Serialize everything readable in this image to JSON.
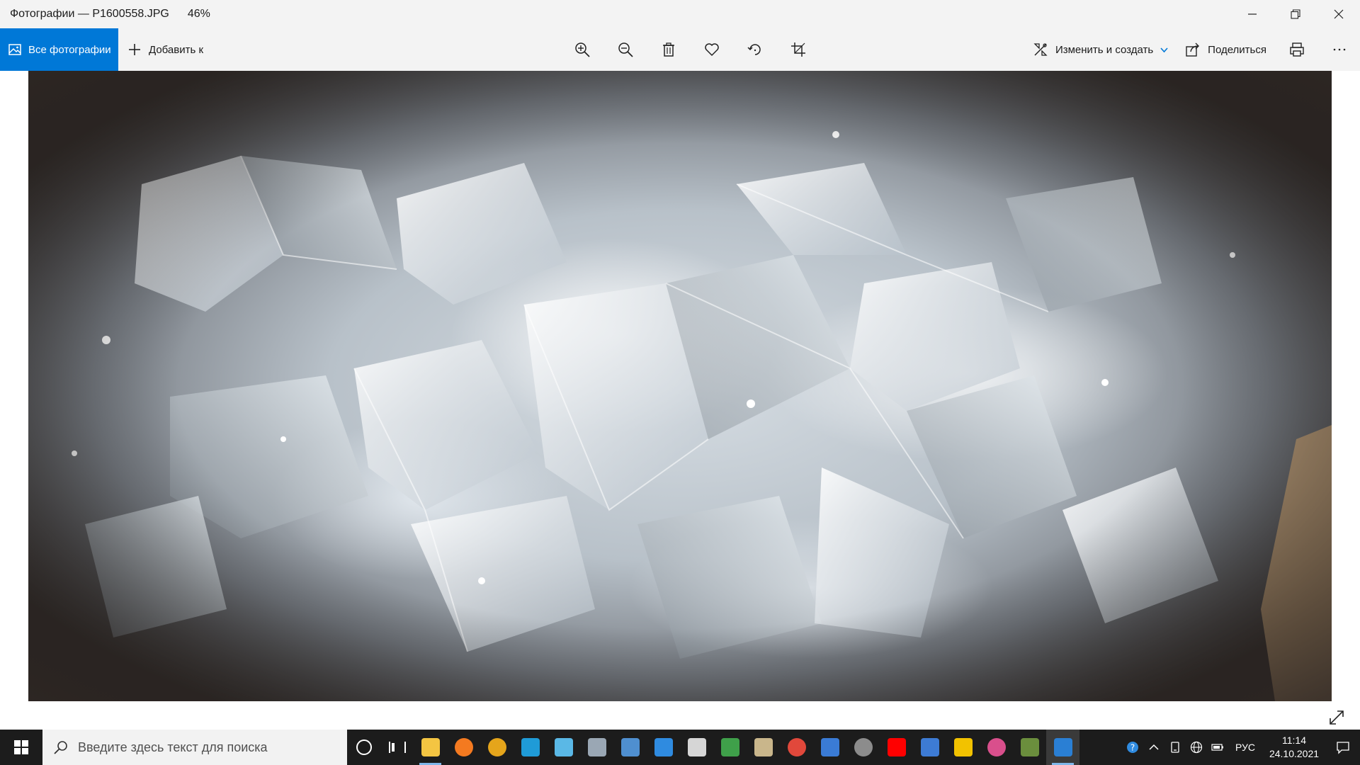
{
  "window": {
    "title": "Фотографии — P1600558.JPG",
    "zoom": "46%",
    "controls": {
      "minimize_icon": "minimize-icon",
      "restore_icon": "restore-icon",
      "close_icon": "close-icon"
    }
  },
  "toolbar": {
    "all_photos_label": "Все фотографии",
    "add_to_label": "Добавить к",
    "tools": [
      "zoom-in-icon",
      "zoom-out-icon",
      "delete-icon",
      "favorite-icon",
      "rotate-icon",
      "crop-icon"
    ],
    "edit_create_label": "Изменить и создать",
    "share_label": "Поделиться",
    "print_icon": "printer-icon",
    "more_icon": "more-icon",
    "accent_color": "#0078d7"
  },
  "photo": {
    "subject": "photo-image",
    "expand_icon": "fullscreen-icon"
  },
  "taskbar": {
    "search_placeholder": "Введите здесь текст для поиска",
    "apps": [
      {
        "name": "cortana",
        "color": "#1c1c1c"
      },
      {
        "name": "task-view",
        "color": "#1c1c1c"
      },
      {
        "name": "file-explorer",
        "color": "#f4c542"
      },
      {
        "name": "app-orange",
        "color": "#f47a20"
      },
      {
        "name": "app-browser-gold",
        "color": "#e5a51b"
      },
      {
        "name": "edge",
        "color": "#1f9bd7"
      },
      {
        "name": "app-cyan",
        "color": "#5ab8e6"
      },
      {
        "name": "app-chart",
        "color": "#9aa7b4"
      },
      {
        "name": "app-image-blue",
        "color": "#4f8fd0"
      },
      {
        "name": "internet-explorer",
        "color": "#2f8be0"
      },
      {
        "name": "app-paint",
        "color": "#d6d6d6"
      },
      {
        "name": "app-green-box",
        "color": "#3fa04a"
      },
      {
        "name": "app-palette",
        "color": "#c9b68b"
      },
      {
        "name": "chrome",
        "color": "#e1483b"
      },
      {
        "name": "app-film",
        "color": "#3a7bd5"
      },
      {
        "name": "app-camera",
        "color": "#8c8c8c"
      },
      {
        "name": "youtube",
        "color": "#ff0000"
      },
      {
        "name": "app-scissors",
        "color": "#3d7bd4"
      },
      {
        "name": "app-warning",
        "color": "#f2c200"
      },
      {
        "name": "app-drop",
        "color": "#d94f8c"
      },
      {
        "name": "app-turtle",
        "color": "#6b8e3d"
      },
      {
        "name": "photos",
        "color": "#2a7fd4"
      }
    ],
    "tray": {
      "help_icon": "help-icon",
      "chevron_icon": "chevron-up-icon",
      "language": "РУС",
      "time": "11:14",
      "date": "24.10.2021"
    }
  }
}
